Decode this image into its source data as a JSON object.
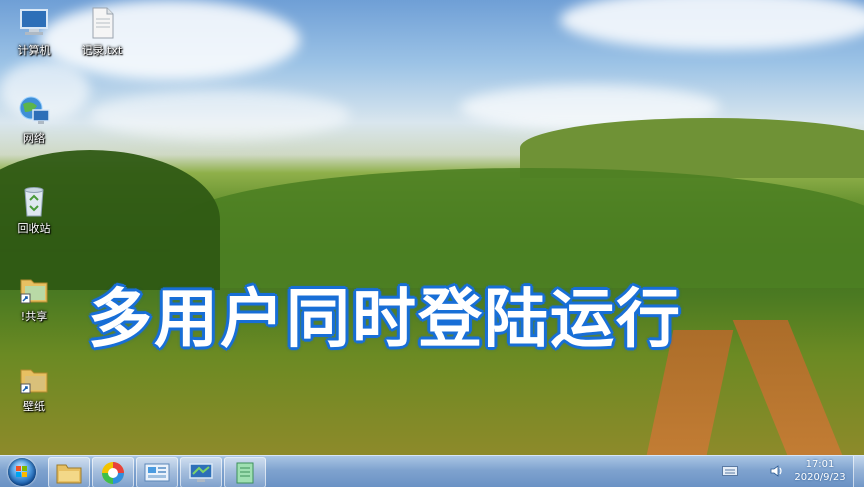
{
  "desktop": {
    "icons": [
      {
        "label": "计算机",
        "icon": "computer-icon"
      },
      {
        "label": "记录.txt",
        "icon": "text-file-icon"
      },
      {
        "label": "网络",
        "icon": "network-icon"
      },
      {
        "label": "回收站",
        "icon": "recycle-bin-icon"
      },
      {
        "label": "!共享",
        "icon": "folder-shortcut-icon"
      },
      {
        "label": "壁纸",
        "icon": "folder-shortcut-icon"
      }
    ],
    "headline": "多用户同时登陆运行"
  },
  "taskbar": {
    "pinned": [
      {
        "name": "explorer",
        "icon": "folder-icon"
      },
      {
        "name": "browser",
        "icon": "colorful-browser-icon"
      },
      {
        "name": "control-panel",
        "icon": "control-panel-icon"
      },
      {
        "name": "remote-desktop",
        "icon": "remote-desktop-icon"
      },
      {
        "name": "notepad",
        "icon": "notepad-icon"
      }
    ],
    "clock": {
      "time": "17:01",
      "date": "2020/9/23"
    },
    "accent": "#1a6fd5"
  }
}
